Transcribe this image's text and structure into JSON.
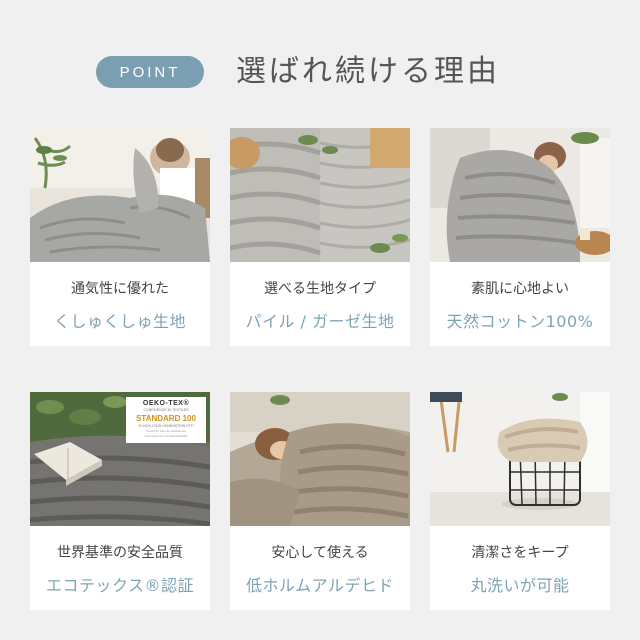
{
  "header": {
    "badge": "POINT",
    "title": "選ばれ続ける理由"
  },
  "cards": [
    {
      "line1": "通気性に優れた",
      "line2": "くしゅくしゅ生地",
      "photo": "woman-with-blanket-on-sofa"
    },
    {
      "line1": "選べる生地タイプ",
      "line2": "パイル / ガーゼ生地",
      "photo": "pile-and-gauze-fabric"
    },
    {
      "line1": "素肌に心地よい",
      "line2": "天然コットン100%",
      "photo": "woman-wrapped-in-blanket"
    },
    {
      "line1": "世界基準の安全品質",
      "line2": "エコテックス®認証",
      "photo": "blanket-with-book-and-plants"
    },
    {
      "line1": "安心して使える",
      "line2": "低ホルムアルデヒド",
      "photo": "woman-sleeping-under-blanket"
    },
    {
      "line1": "清潔さをキープ",
      "line2": "丸洗いが可能",
      "photo": "blanket-in-wire-basket"
    }
  ],
  "oeko_label": {
    "brand": "OEKO-TEX®",
    "sub": "CONFIDENCE IN TEXTILES",
    "standard": "STANDARD 100",
    "id_line": "20.HCN.17625 HOHENSTEIN HTTI",
    "tested": "Tested for harmful substances",
    "url": "www.oeko-tex.com/standard100"
  },
  "colors": {
    "background": "#f0f0f0",
    "accent": "#7fa3b6",
    "pill": "#7b9fb2",
    "text": "#444444"
  }
}
